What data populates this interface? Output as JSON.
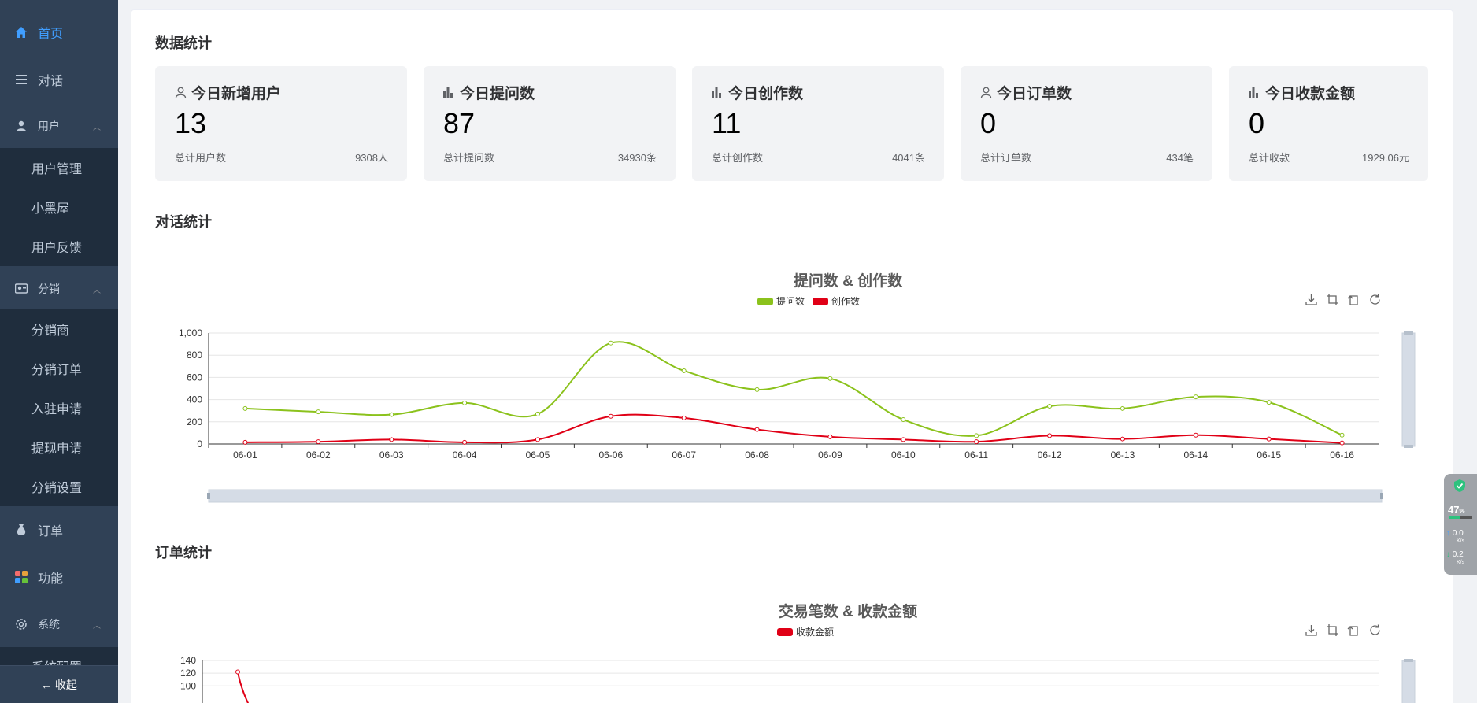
{
  "sidebar": {
    "items": [
      {
        "label": "首页",
        "icon": "home-icon",
        "active": true
      },
      {
        "label": "对话",
        "icon": "menu-icon"
      },
      {
        "label": "用户",
        "icon": "user-icon"
      },
      {
        "label": "分销",
        "icon": "distribution-icon"
      },
      {
        "label": "订单",
        "icon": "moneybag-icon"
      },
      {
        "label": "功能",
        "icon": "grid-icon"
      },
      {
        "label": "系统",
        "icon": "gear-icon"
      }
    ],
    "user_sub": [
      "用户管理",
      "小黑屋",
      "用户反馈"
    ],
    "dist_sub": [
      "分销商",
      "分销订单",
      "入驻申请",
      "提现申请",
      "分销设置"
    ],
    "system_sub": [
      "系统配置"
    ],
    "collapse_label": "← 收起"
  },
  "sections": {
    "data": "数据统计",
    "chat": "对话统计",
    "order": "订单统计"
  },
  "stats": [
    {
      "icon": "user-icon",
      "title": "今日新增用户",
      "value": "13",
      "total_label": "总计用户数",
      "total_value": "9308人"
    },
    {
      "icon": "bar-chart-icon",
      "title": "今日提问数",
      "value": "87",
      "total_label": "总计提问数",
      "total_value": "34930条"
    },
    {
      "icon": "bar-chart-icon",
      "title": "今日创作数",
      "value": "11",
      "total_label": "总计创作数",
      "total_value": "4041条"
    },
    {
      "icon": "user-icon",
      "title": "今日订单数",
      "value": "0",
      "total_label": "总计订单数",
      "total_value": "434笔"
    },
    {
      "icon": "bar-chart-icon",
      "title": "今日收款金额",
      "value": "0",
      "total_label": "总计收款",
      "total_value": "1929.06元"
    }
  ],
  "chart_data": [
    {
      "type": "line",
      "title": "提问数 & 创作数",
      "categories": [
        "06-01",
        "06-02",
        "06-03",
        "06-04",
        "06-05",
        "06-06",
        "06-07",
        "06-08",
        "06-09",
        "06-10",
        "06-11",
        "06-12",
        "06-13",
        "06-14",
        "06-15",
        "06-16"
      ],
      "ylim": [
        0,
        1000
      ],
      "yticks": [
        "0",
        "200",
        "400",
        "600",
        "800",
        "1,000"
      ],
      "series": [
        {
          "name": "提问数",
          "color": "#8bc21c",
          "values": [
            320,
            290,
            265,
            370,
            270,
            910,
            660,
            490,
            590,
            220,
            75,
            340,
            320,
            425,
            375,
            80
          ]
        },
        {
          "name": "创作数",
          "color": "#e00016",
          "values": [
            15,
            20,
            40,
            15,
            40,
            250,
            235,
            130,
            65,
            40,
            20,
            75,
            45,
            80,
            45,
            10
          ]
        }
      ],
      "legend": "top-center",
      "grid": true
    },
    {
      "type": "line",
      "title": "交易笔数 & 收款金额",
      "ylim": [
        0,
        140
      ],
      "yticks": [
        "100",
        "120",
        "140"
      ],
      "series": [
        {
          "name": "收款金额",
          "color": "#e00016",
          "values": [
            122
          ]
        }
      ],
      "legend": "top-center",
      "grid": true
    }
  ],
  "widget": {
    "percent": "47",
    "unit": "%",
    "up": "0.0",
    "down": "0.2",
    "rate_unit": "K/s"
  }
}
